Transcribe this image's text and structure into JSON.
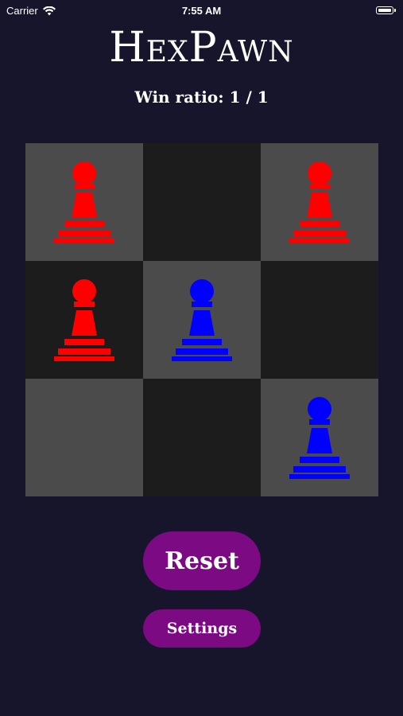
{
  "status_bar": {
    "carrier": "Carrier",
    "time": "7:55 AM"
  },
  "app": {
    "title": "HexPawn",
    "win_ratio": "Win ratio: 1 / 1"
  },
  "colors": {
    "background": "#16152b",
    "light_square": "#4b4b4b",
    "dark_square": "#1c1c1c",
    "red_pawn": "#ff0000",
    "blue_pawn": "#0000ff",
    "button": "#7b0a83"
  },
  "board": {
    "rows": [
      [
        {
          "shade": "light",
          "piece": "red"
        },
        {
          "shade": "dark",
          "piece": null
        },
        {
          "shade": "light",
          "piece": "red"
        }
      ],
      [
        {
          "shade": "dark",
          "piece": "red"
        },
        {
          "shade": "light",
          "piece": "blue"
        },
        {
          "shade": "dark",
          "piece": null
        }
      ],
      [
        {
          "shade": "light",
          "piece": null
        },
        {
          "shade": "dark",
          "piece": null
        },
        {
          "shade": "light",
          "piece": "blue"
        }
      ]
    ]
  },
  "buttons": {
    "reset_label": "Reset",
    "settings_label": "Settings"
  }
}
